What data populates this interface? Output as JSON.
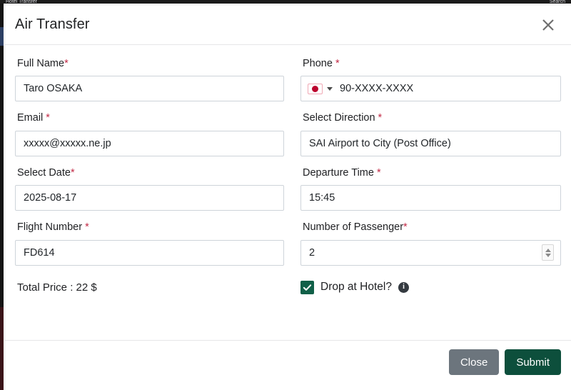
{
  "backdrop": {
    "ghost_left": "Hotel Transfer",
    "ghost_right": "Search"
  },
  "modal": {
    "title": "Air Transfer",
    "close_icon": "close-icon",
    "fields": {
      "full_name": {
        "label": "Full Name",
        "required_mark": "*",
        "value": "Taro OSAKA"
      },
      "phone": {
        "label": "Phone",
        "required_mark": "*",
        "country_flag": "jp-flag-icon",
        "dropdown_icon": "chevron-down-icon",
        "value": "90-XXXX-XXXX"
      },
      "email": {
        "label": "Email",
        "required_mark": "*",
        "value": "xxxxx@xxxxx.ne.jp"
      },
      "direction": {
        "label": "Select Direction",
        "required_mark": "*",
        "value": "SAI Airport to City (Post Office)"
      },
      "date": {
        "label": "Select Date",
        "required_mark": "*",
        "value": "2025-08-17"
      },
      "departure_time": {
        "label": "Departure Time",
        "required_mark": "*",
        "value": "15:45"
      },
      "flight_number": {
        "label": "Flight Number",
        "required_mark": "*",
        "value": "FD614"
      },
      "passengers": {
        "label": "Number of Passenger",
        "required_mark": "*",
        "value": "2",
        "stepper_icon": "spinner-icon"
      }
    },
    "total_price": "Total Price : 22 $",
    "drop_at_hotel": {
      "label": "Drop at Hotel?",
      "checked": true,
      "checkbox_icon": "check-icon",
      "info_icon": "info-icon",
      "info_glyph": "i"
    },
    "footer": {
      "close_label": "Close",
      "submit_label": "Submit"
    }
  },
  "colors": {
    "required_red": "#c22a46",
    "submit_green": "#0d4f3c",
    "close_gray": "#6c757d",
    "checkbox_green": "#106048",
    "flag_red": "#bc002d"
  }
}
